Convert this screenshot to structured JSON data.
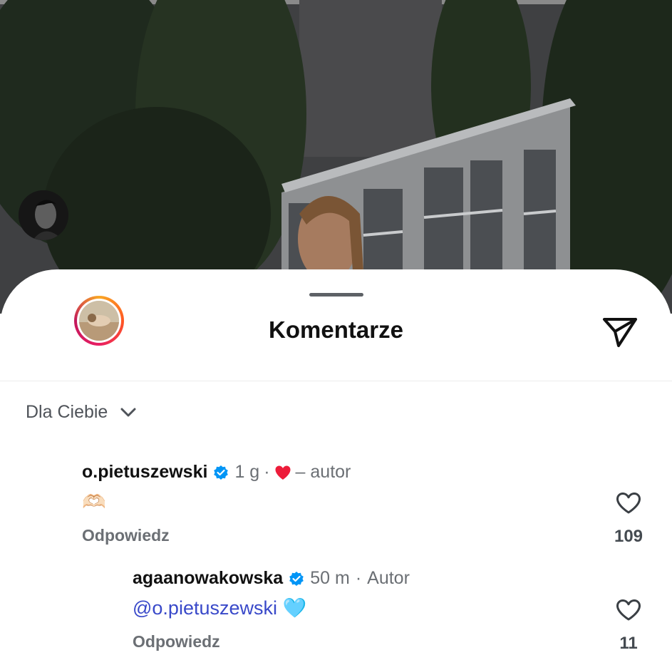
{
  "sheet": {
    "title": "Komentarze",
    "share_icon": "paper-plane-icon",
    "sort": {
      "label": "Dla Ciebie",
      "icon": "chevron-down-icon"
    }
  },
  "comments": [
    {
      "username": "o.pietuszewski",
      "verified": true,
      "time": "1 g",
      "separator": "·",
      "liked_by_author_icon": "red-heart-icon",
      "author_note": "– autor",
      "text": "🫶🏻",
      "reply_label": "Odpowiedz",
      "like_count": "109"
    },
    {
      "username": "agaanowakowska",
      "verified": true,
      "time": "50 m",
      "separator": "·",
      "author_badge": "Autor",
      "mention": "@o.pietuszewski",
      "emoji": "🩵",
      "reply_label": "Odpowiedz",
      "like_count": "11"
    }
  ],
  "colors": {
    "verified_blue": "#0095f6",
    "mention_blue": "#3949c9",
    "heart_red": "#ed1c3a",
    "muted_text": "#6b6f74"
  }
}
